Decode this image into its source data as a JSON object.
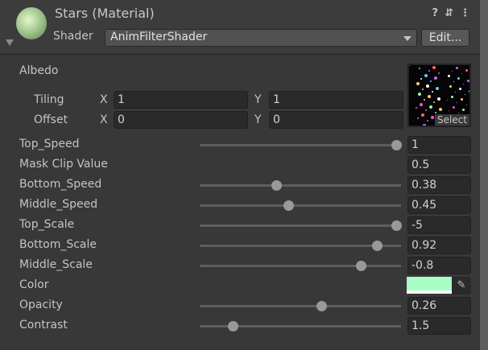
{
  "header": {
    "title": "Stars (Material)",
    "shader_label": "Shader",
    "shader_value": "AnimFilterShader",
    "edit_label": "Edit..."
  },
  "albedo": {
    "label": "Albedo",
    "select_label": "Select",
    "tiling": {
      "label": "Tiling",
      "x_label": "X",
      "x": "1",
      "y_label": "Y",
      "y": "1"
    },
    "offset": {
      "label": "Offset",
      "x_label": "X",
      "x": "0",
      "y_label": "Y",
      "y": "0"
    }
  },
  "properties": [
    {
      "label": "Top_Speed",
      "value": "1",
      "slider": 1.0
    },
    {
      "label": "Mask Clip Value",
      "value": "0.5"
    },
    {
      "label": "Bottom_Speed",
      "value": "0.38",
      "slider": 0.39
    },
    {
      "label": "Middle_Speed",
      "value": "0.45",
      "slider": 0.45
    },
    {
      "label": "Top_Scale",
      "value": "-5",
      "slider": 1.0
    },
    {
      "label": "Bottom_Scale",
      "value": "0.92",
      "slider": 0.9
    },
    {
      "label": "Middle_Scale",
      "value": "-0.8",
      "slider": 0.82
    },
    {
      "label": "Color",
      "color": "#a8fdc6"
    },
    {
      "label": "Opacity",
      "value": "0.26",
      "slider": 0.62
    },
    {
      "label": "Contrast",
      "value": "1.5",
      "slider": 0.17
    }
  ]
}
